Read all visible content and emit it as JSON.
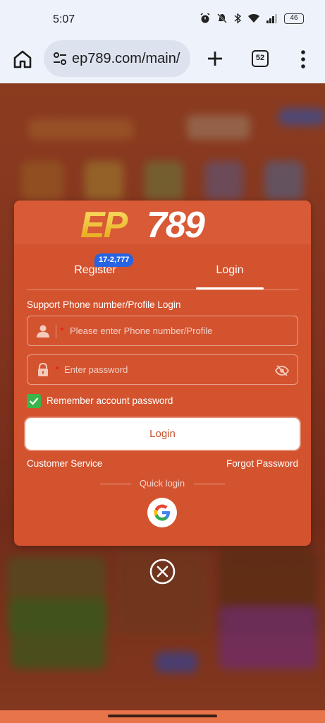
{
  "status_bar": {
    "time": "5:07",
    "battery": "46",
    "icons": [
      "alarm-icon",
      "mute-icon",
      "bluetooth-icon",
      "wifi-icon",
      "signal-icon",
      "battery-icon"
    ]
  },
  "browser": {
    "url": "ep789.com/main/",
    "tab_count": "52",
    "icons": [
      "home-icon",
      "site-settings-icon",
      "plus-icon",
      "tabs-icon",
      "menu-icon"
    ]
  },
  "modal": {
    "logo_text": "EP789",
    "tabs": [
      {
        "label": "Register",
        "badge": "17-2,777",
        "active": false
      },
      {
        "label": "Login",
        "active": true
      }
    ],
    "field_label": "Support Phone number/Profile Login",
    "phone_placeholder": "Please enter Phone number/Profile",
    "password_placeholder": "Enter password",
    "remember_label": "Remember account password",
    "remember_checked": true,
    "login_button": "Login",
    "customer_service": "Customer Service",
    "forgot_password": "Forgot Password",
    "quick_login": "Quick login"
  },
  "colors": {
    "modal_bg": "#d4532f",
    "badge_bg": "#2664e3",
    "checkbox_bg": "#3bb54a",
    "logo_gold": "#f4c21a",
    "logo_white": "#ffffff"
  }
}
